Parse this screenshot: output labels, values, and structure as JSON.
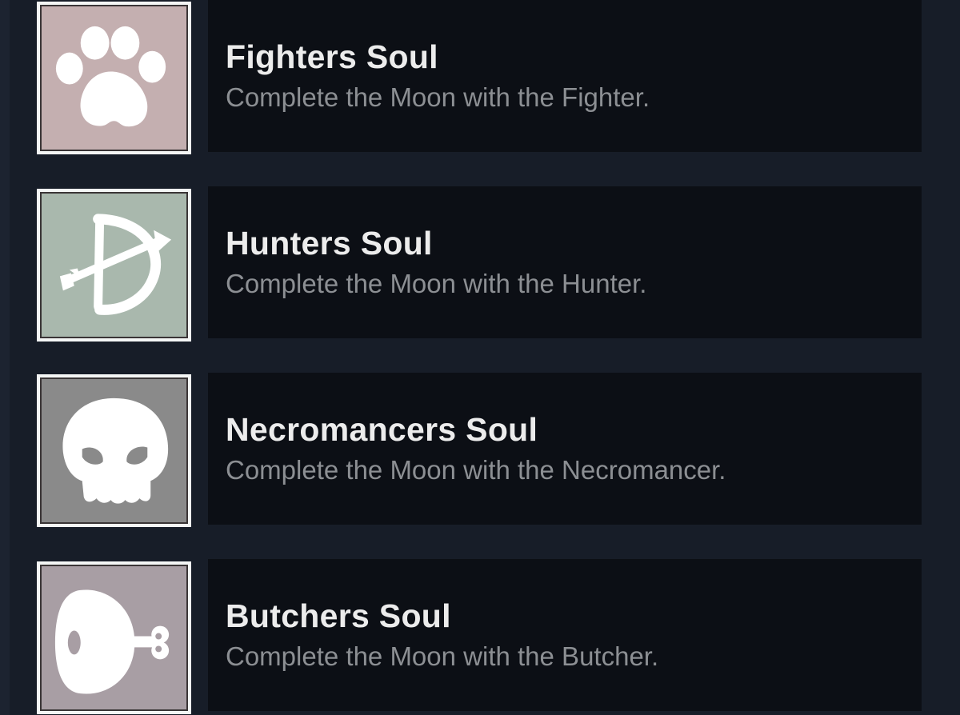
{
  "achievements": [
    {
      "title": "Fighters Soul",
      "description": "Complete the Moon with the Fighter.",
      "icon": "paw-icon",
      "icon_bg": "#c4afb0"
    },
    {
      "title": "Hunters Soul",
      "description": "Complete the Moon with the Hunter.",
      "icon": "bow-and-arrow-icon",
      "icon_bg": "#a9b8ad"
    },
    {
      "title": "Necromancers Soul",
      "description": "Complete the Moon with the Necromancer.",
      "icon": "skull-icon",
      "icon_bg": "#8a8a8a"
    },
    {
      "title": "Butchers Soul",
      "description": "Complete the Moon with the Butcher.",
      "icon": "meat-icon",
      "icon_bg": "#a89ea4"
    }
  ],
  "colors": {
    "page_bg": "#171d28",
    "card_bg": "#0c0f15",
    "title": "#ececec",
    "description": "#8c8f93",
    "icon_frame": "#f4f6f5"
  }
}
